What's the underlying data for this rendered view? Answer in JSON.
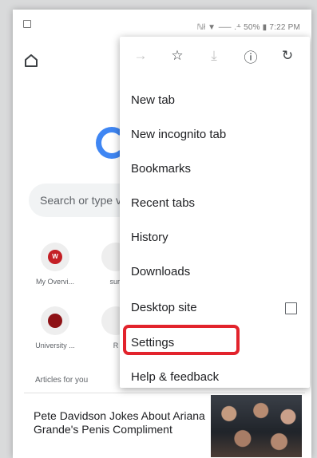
{
  "status_bar": {
    "text": "ℕł ▼ ⸺ .⸛ 50% ▮ 7:22 PM"
  },
  "page": {
    "search_placeholder": "Search or type v",
    "tiles": [
      {
        "label": "My Overvi...",
        "badge": "W"
      },
      {
        "label": "surf",
        "badge": ""
      },
      {
        "label": "University ...",
        "badge": ""
      },
      {
        "label": "R",
        "badge": ""
      }
    ],
    "articles_header": "Articles for you",
    "article": {
      "title": "Pete Davidson Jokes About Ariana Grande's Penis Compliment"
    }
  },
  "menu": {
    "toolbar": [
      {
        "name": "forward-icon",
        "glyph": "→",
        "disabled": true
      },
      {
        "name": "star-icon",
        "glyph": "☆",
        "disabled": false
      },
      {
        "name": "download-icon",
        "glyph": "⤓",
        "disabled": true
      },
      {
        "name": "info-icon",
        "glyph": "ⓘ",
        "disabled": false
      },
      {
        "name": "refresh-icon",
        "glyph": "↻",
        "disabled": false
      }
    ],
    "items": [
      {
        "label": "New tab"
      },
      {
        "label": "New incognito tab"
      },
      {
        "label": "Bookmarks"
      },
      {
        "label": "Recent tabs"
      },
      {
        "label": "History"
      },
      {
        "label": "Downloads"
      },
      {
        "label": "Desktop site",
        "checkbox": false
      },
      {
        "label": "Settings",
        "highlighted": true
      },
      {
        "label": "Help & feedback"
      }
    ]
  },
  "colors": {
    "accent_blue": "#3f86f3",
    "highlight_red": "#e2232c",
    "tile_red": "#c41f25"
  }
}
